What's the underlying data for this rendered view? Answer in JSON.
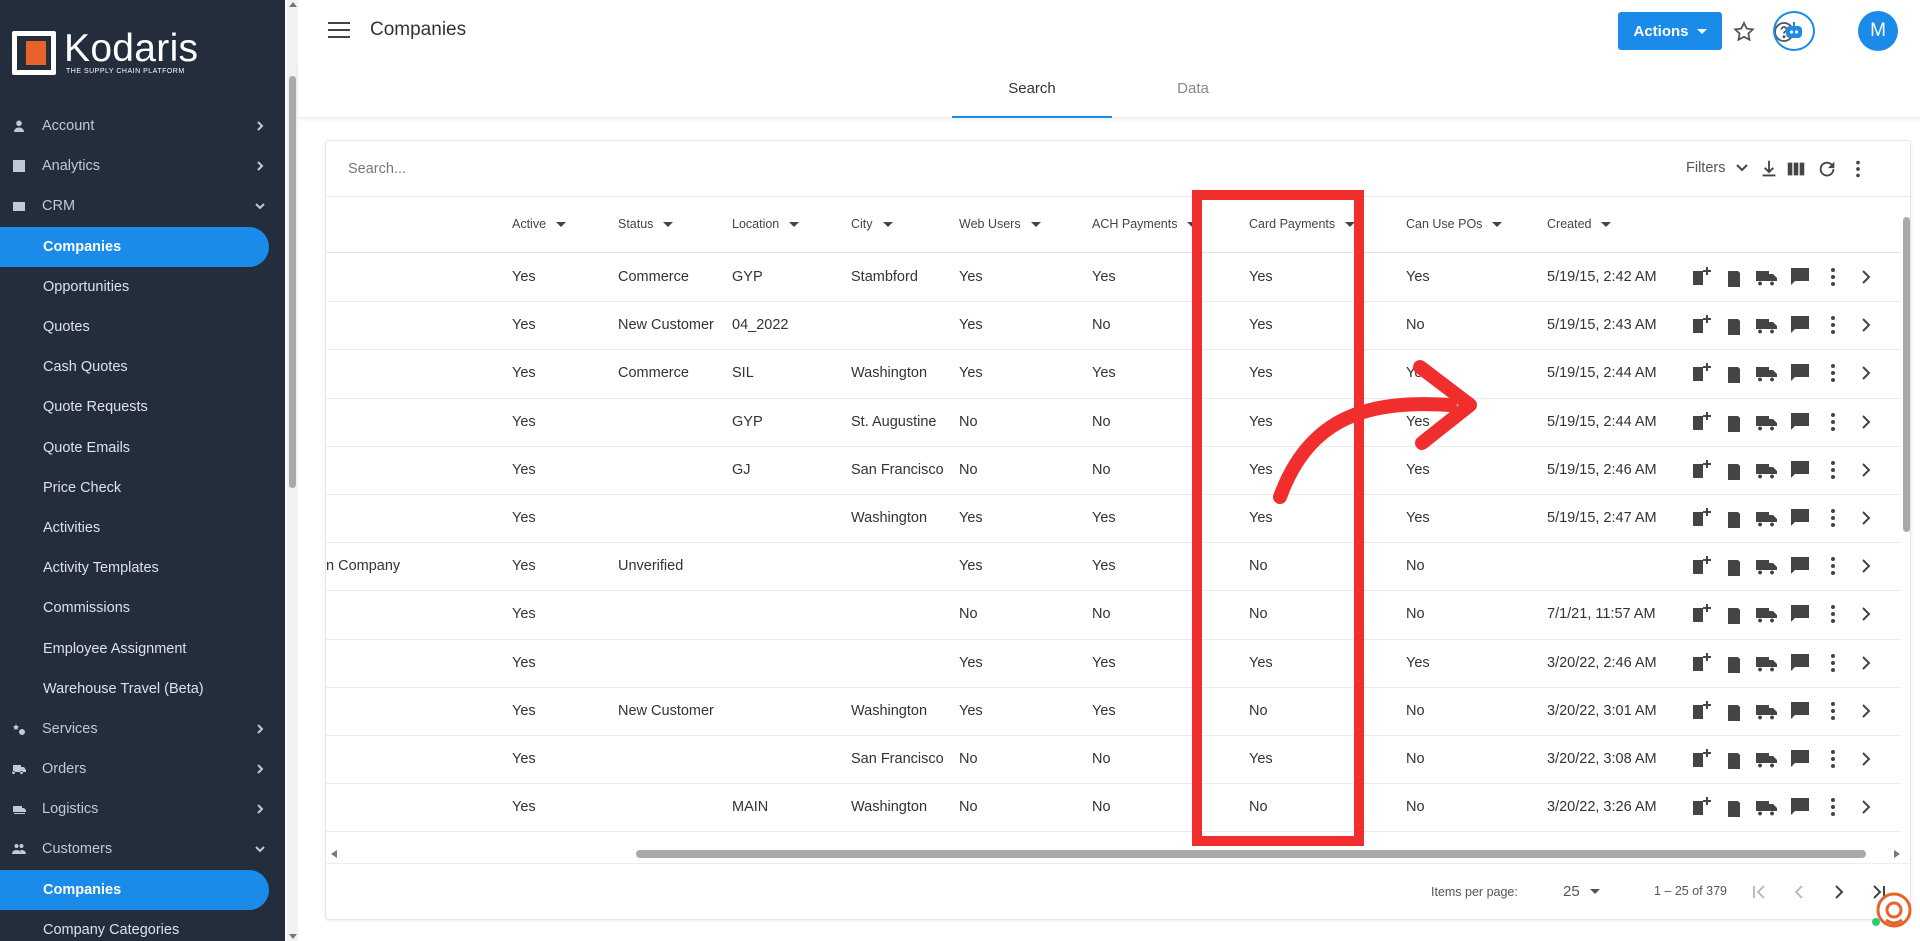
{
  "logo": {
    "name": "Kodaris",
    "tagline": "THE SUPPLY CHAIN PLATFORM"
  },
  "sidebar": {
    "items": [
      {
        "label": "Account",
        "icon": "person-icon",
        "expanded": false
      },
      {
        "label": "Analytics",
        "icon": "analytics-icon",
        "expanded": false
      },
      {
        "label": "CRM",
        "icon": "crm-icon",
        "expanded": true
      },
      {
        "label": "Services",
        "icon": "services-icon",
        "expanded": false
      },
      {
        "label": "Orders",
        "icon": "truck-icon",
        "expanded": false
      },
      {
        "label": "Logistics",
        "icon": "logistics-icon",
        "expanded": false
      },
      {
        "label": "Customers",
        "icon": "people-icon",
        "expanded": true
      }
    ],
    "crm_sub": [
      "Companies",
      "Opportunities",
      "Quotes",
      "Cash Quotes",
      "Quote Requests",
      "Quote Emails",
      "Price Check",
      "Activities",
      "Activity Templates",
      "Commissions",
      "Employee Assignment",
      "Warehouse Travel (Beta)"
    ],
    "customers_sub": [
      "Companies",
      "Company Categories"
    ]
  },
  "header": {
    "title": "Companies",
    "actions_label": "Actions",
    "avatar_initial": "M"
  },
  "tabs": [
    "Search",
    "Data"
  ],
  "toolbar": {
    "search_placeholder": "Search...",
    "filters_label": "Filters"
  },
  "table": {
    "columns": [
      "Active",
      "Status",
      "Location",
      "City",
      "Web Users",
      "ACH Payments",
      "Card Payments",
      "Can Use POs",
      "Created"
    ],
    "rows": [
      {
        "name": "",
        "active": "Yes",
        "status": "Commerce",
        "location": "GYP",
        "city": "Stambford",
        "web": "Yes",
        "ach": "Yes",
        "card": "Yes",
        "po": "Yes",
        "created": "5/19/15, 2:42 AM"
      },
      {
        "name": "",
        "active": "Yes",
        "status": "New Customer",
        "location": "04_2022",
        "city": "",
        "web": "Yes",
        "ach": "No",
        "card": "Yes",
        "po": "No",
        "created": "5/19/15, 2:43 AM"
      },
      {
        "name": "",
        "active": "Yes",
        "status": "Commerce",
        "location": "SIL",
        "city": "Washington",
        "web": "Yes",
        "ach": "Yes",
        "card": "Yes",
        "po": "Yes",
        "created": "5/19/15, 2:44 AM"
      },
      {
        "name": "",
        "active": "Yes",
        "status": "",
        "location": "GYP",
        "city": "St. Augustine",
        "web": "No",
        "ach": "No",
        "card": "Yes",
        "po": "Yes",
        "created": "5/19/15, 2:44 AM"
      },
      {
        "name": "",
        "active": "Yes",
        "status": "",
        "location": "GJ",
        "city": "San Francisco",
        "web": "No",
        "ach": "No",
        "card": "Yes",
        "po": "Yes",
        "created": "5/19/15, 2:46 AM"
      },
      {
        "name": "",
        "active": "Yes",
        "status": "",
        "location": "",
        "city": "Washington",
        "web": "Yes",
        "ach": "Yes",
        "card": "Yes",
        "po": "Yes",
        "created": "5/19/15, 2:47 AM"
      },
      {
        "name": "n Company",
        "active": "Yes",
        "status": "Unverified",
        "location": "",
        "city": "",
        "web": "Yes",
        "ach": "Yes",
        "card": "No",
        "po": "No",
        "created": ""
      },
      {
        "name": "",
        "active": "Yes",
        "status": "",
        "location": "",
        "city": "",
        "web": "No",
        "ach": "No",
        "card": "No",
        "po": "No",
        "created": "7/1/21, 11:57 AM"
      },
      {
        "name": "",
        "active": "Yes",
        "status": "",
        "location": "",
        "city": "",
        "web": "Yes",
        "ach": "Yes",
        "card": "Yes",
        "po": "Yes",
        "created": "3/20/22, 2:46 AM"
      },
      {
        "name": "",
        "active": "Yes",
        "status": "New Customer",
        "location": "",
        "city": "Washington",
        "web": "Yes",
        "ach": "Yes",
        "card": "No",
        "po": "No",
        "created": "3/20/22, 3:01 AM"
      },
      {
        "name": "",
        "active": "Yes",
        "status": "",
        "location": "",
        "city": "San Francisco",
        "web": "No",
        "ach": "No",
        "card": "Yes",
        "po": "No",
        "created": "3/20/22, 3:08 AM"
      },
      {
        "name": "",
        "active": "Yes",
        "status": "",
        "location": "MAIN",
        "city": "Washington",
        "web": "No",
        "ach": "No",
        "card": "No",
        "po": "No",
        "created": "3/20/22, 3:26 AM"
      }
    ]
  },
  "pager": {
    "items_per_page_label": "Items per page:",
    "items_per_page": "25",
    "range": "1 – 25 of 379"
  },
  "colors": {
    "sidebar_bg": "#232d3b",
    "accent": "#1a8be8",
    "highlight": "#f02e2e",
    "logo_orange": "#e8632b"
  }
}
